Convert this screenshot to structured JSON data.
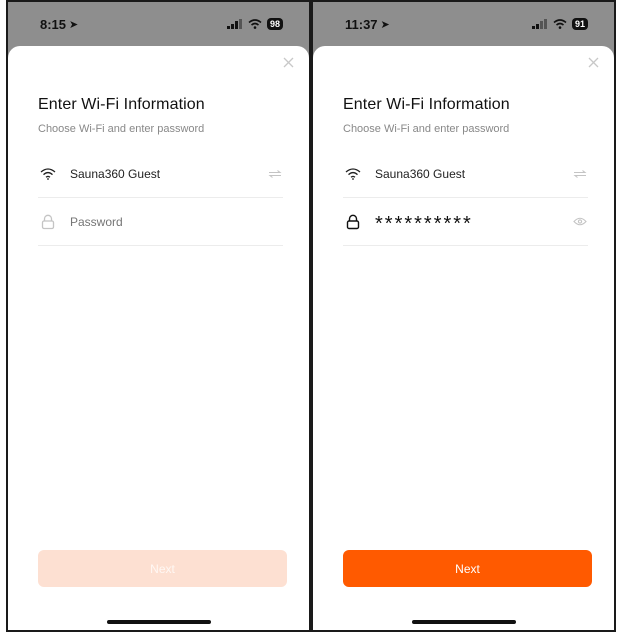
{
  "screens": [
    {
      "status": {
        "time": "8:15",
        "battery": "98"
      },
      "title": "Enter Wi-Fi Information",
      "subtitle": "Choose Wi-Fi and enter password",
      "wifi_name": "Sauna360 Guest",
      "password_placeholder": "Password",
      "password_value": "",
      "next_label": "Next",
      "next_enabled": false
    },
    {
      "status": {
        "time": "11:37",
        "battery": "91"
      },
      "title": "Enter Wi-Fi Information",
      "subtitle": "Choose Wi-Fi and enter password",
      "wifi_name": "Sauna360 Guest",
      "password_masked": "**********",
      "next_label": "Next",
      "next_enabled": true
    }
  ],
  "colors": {
    "accent": "#ff5a00",
    "accent_disabled": "#fde0d2",
    "sheet_backdrop": "#8e8e8e"
  },
  "icons": {
    "location": "location-arrow-icon",
    "signal": "cellular-signal-icon",
    "wifi_status": "wifi-status-icon",
    "battery": "battery-icon",
    "close": "close-icon",
    "wifi": "wifi-icon",
    "switch": "switch-network-icon",
    "lock": "lock-icon",
    "eye": "eye-icon"
  }
}
